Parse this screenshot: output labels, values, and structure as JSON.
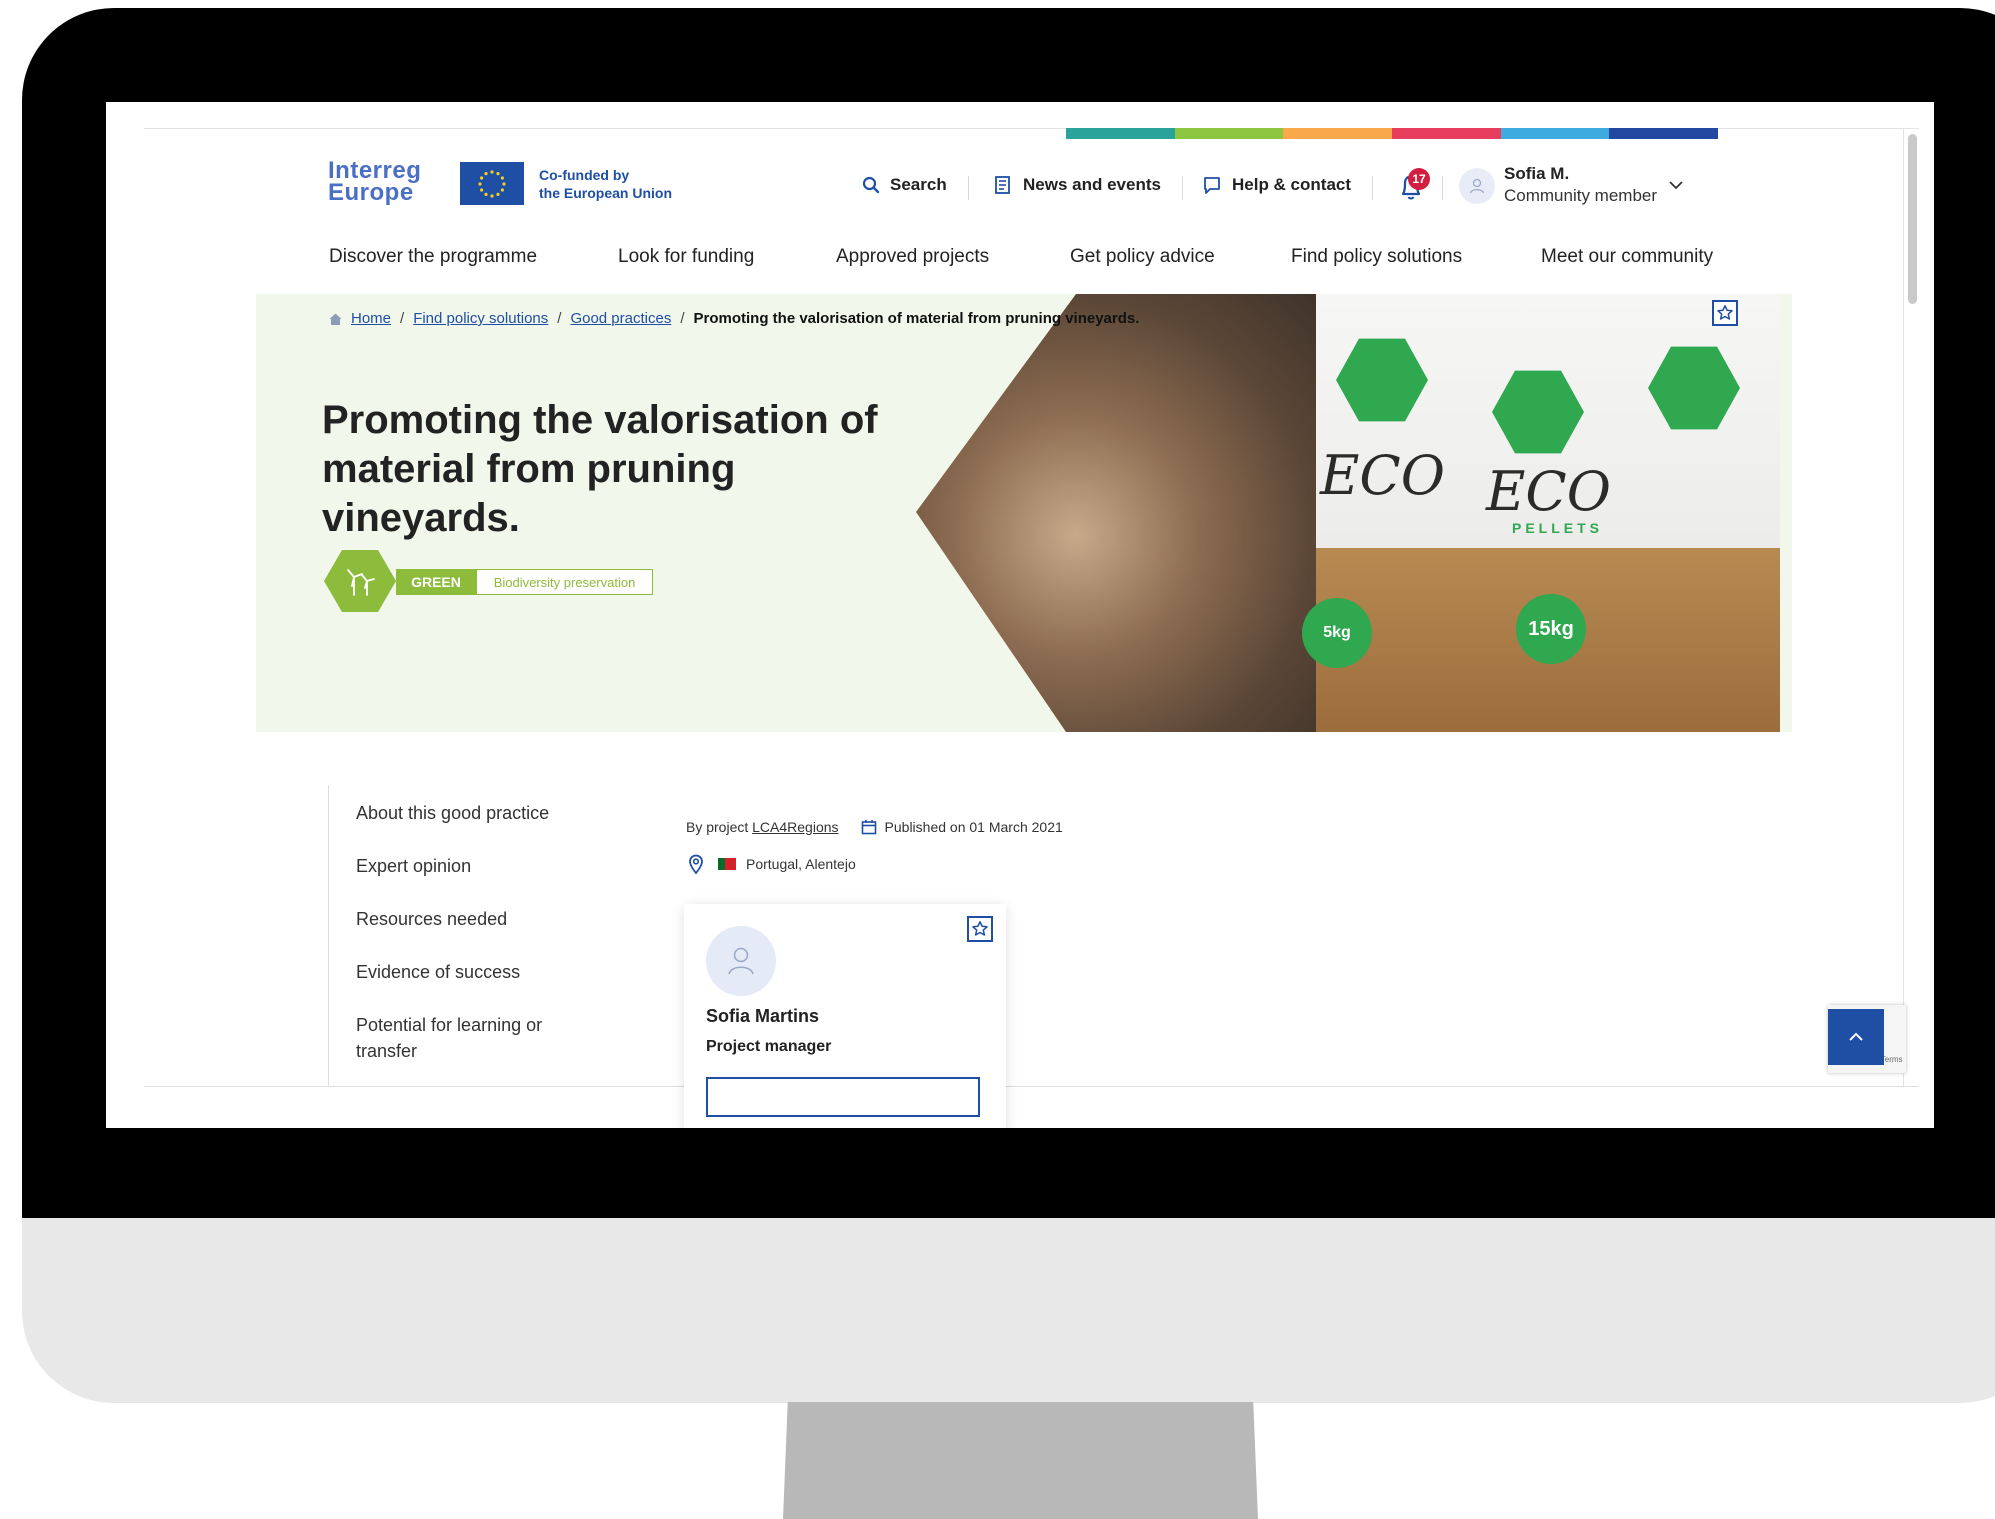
{
  "colors": {
    "brand_blue": "#1f4fa5",
    "logo_blue": "#4a6fc4",
    "green_tag": "#8dbb3b",
    "notification_red": "#d31f3f",
    "brand_strip": [
      "#2aa39a",
      "#8dc63f",
      "#f7a94c",
      "#e63e5c",
      "#3dabdf",
      "#2247a0"
    ]
  },
  "header": {
    "logo_line1": "Interreg",
    "logo_line2": "Europe",
    "cofunded_line1": "Co-funded by",
    "cofunded_line2": "the European Union",
    "search_label": "Search",
    "news_label": "News and events",
    "help_label": "Help & contact",
    "notifications_count": "17",
    "user_name": "Sofia M.",
    "user_role": "Community member"
  },
  "nav": {
    "items": [
      "Discover the programme",
      "Look for funding",
      "Approved projects",
      "Get policy advice",
      "Find policy solutions",
      "Meet our community"
    ]
  },
  "breadcrumb": {
    "home": "Home",
    "level1": "Find policy solutions",
    "level2": "Good practices",
    "current": "Promoting the valorisation of material from pruning vineyards."
  },
  "hero": {
    "title": "Promoting the valorisation of material from pruning vineyards.",
    "tag_category": "GREEN",
    "tag_topic": "Biodiversity preservation",
    "image_text": {
      "brand": "ECO",
      "brand_sub": "PELLETS",
      "weight": "15kg",
      "weight_small": "5kg"
    }
  },
  "sidemenu": {
    "items": [
      "About this good practice",
      "Expert opinion",
      "Resources needed",
      "Evidence of success",
      "Potential for learning or transfer"
    ]
  },
  "meta": {
    "by_project_prefix": "By project",
    "project_name": "LCA4Regions",
    "published": "Published on 01 March 2021",
    "location": "Portugal, Alentejo"
  },
  "contact_card": {
    "name": "Sofia Martins",
    "role": "Project manager"
  },
  "recaptcha_text": "- Terms"
}
